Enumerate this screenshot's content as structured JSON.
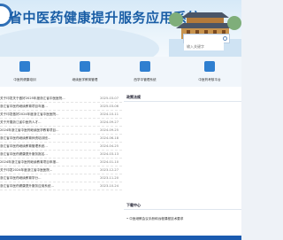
{
  "header": {
    "title": "省中医药健康提升服务应用系统",
    "search_placeholder": "输入关键字"
  },
  "nav": [
    {
      "label": "中医药健康培训",
      "icon": "doctor-icon"
    },
    {
      "label": "继续医学教育管理",
      "icon": "calendar-icon"
    },
    {
      "label": "西学中管理系统",
      "icon": "document-icon"
    },
    {
      "label": "中医药考核平台",
      "icon": "certificate-icon"
    }
  ],
  "news": [
    {
      "title": "关于印发关于做好2025年度浙江省中医医院...",
      "date": "2025-03-07"
    },
    {
      "title": "浙江省中医药继续教育项目年度...",
      "date": "2025-03-06"
    },
    {
      "title": "关于印发做好2024年度浙江省中医医院...",
      "date": "2024-10-11"
    },
    {
      "title": "关于开展浙江省中医药人才...",
      "date": "2024-09-27"
    },
    {
      "title": "2024年浙江省中医药继续医学教育项目...",
      "date": "2024-09-25"
    },
    {
      "title": "浙江省中医药继续教育师资培训班...",
      "date": "2024-06-18"
    },
    {
      "title": "浙江省中医药继续教育管理系统...",
      "date": "2024-04-25"
    },
    {
      "title": "浙江省中医药健康提升服务报名...",
      "date": "2024-03-13"
    },
    {
      "title": "2024年浙江省中医药继续教育项目申报...",
      "date": "2024-01-10"
    },
    {
      "title": "关于印发2024年度浙江省中医医院...",
      "date": "2023-12-27"
    },
    {
      "title": "浙江省中医药继续教育学分...",
      "date": "2023-11-20"
    },
    {
      "title": "浙江省中医药健康提升服务应用系统...",
      "date": "2023-10-24"
    },
    {
      "title": "浙江省中医药继续医学教育项目...",
      "date": "2023-09-05"
    }
  ],
  "policy": {
    "heading": "政策法规"
  },
  "download": {
    "heading": "下载中心",
    "items": [
      {
        "title": "• 中医继教会议手册和远程课程技术要求"
      }
    ]
  }
}
